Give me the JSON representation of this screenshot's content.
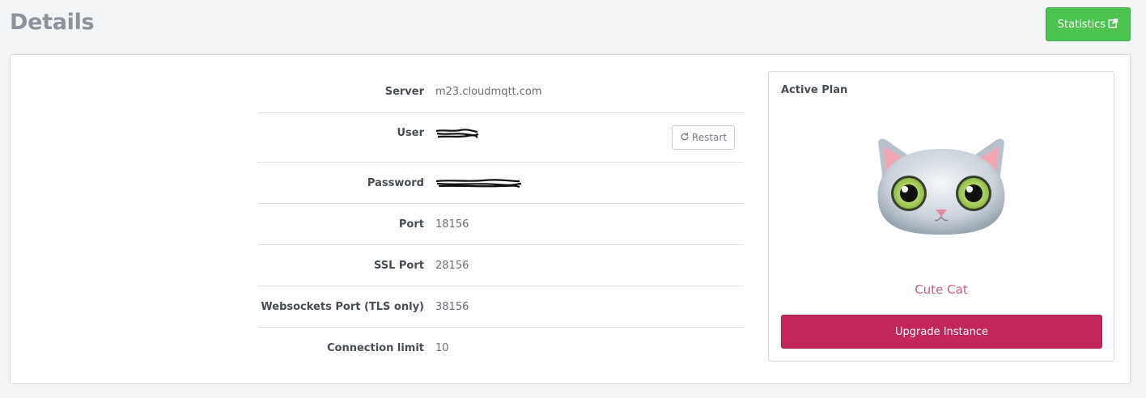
{
  "header": {
    "title": "Details",
    "statistics_label": "Statistics"
  },
  "details": {
    "server": {
      "label": "Server",
      "value": "m23.cloudmqtt.com"
    },
    "user": {
      "label": "User",
      "value": "",
      "restart_label": "Restart"
    },
    "password": {
      "label": "Password",
      "value": ""
    },
    "port": {
      "label": "Port",
      "value": "18156"
    },
    "ssl_port": {
      "label": "SSL Port",
      "value": "28156"
    },
    "websockets_port": {
      "label": "Websockets Port (TLS only)",
      "value": "38156"
    },
    "connection_limit": {
      "label": "Connection limit",
      "value": "10"
    }
  },
  "plan": {
    "title": "Active Plan",
    "name": "Cute Cat",
    "upgrade_label": "Upgrade Instance"
  },
  "colors": {
    "statistics_button": "#4cc24f",
    "upgrade_button": "#c3265b",
    "plan_name": "#cf5c85"
  }
}
